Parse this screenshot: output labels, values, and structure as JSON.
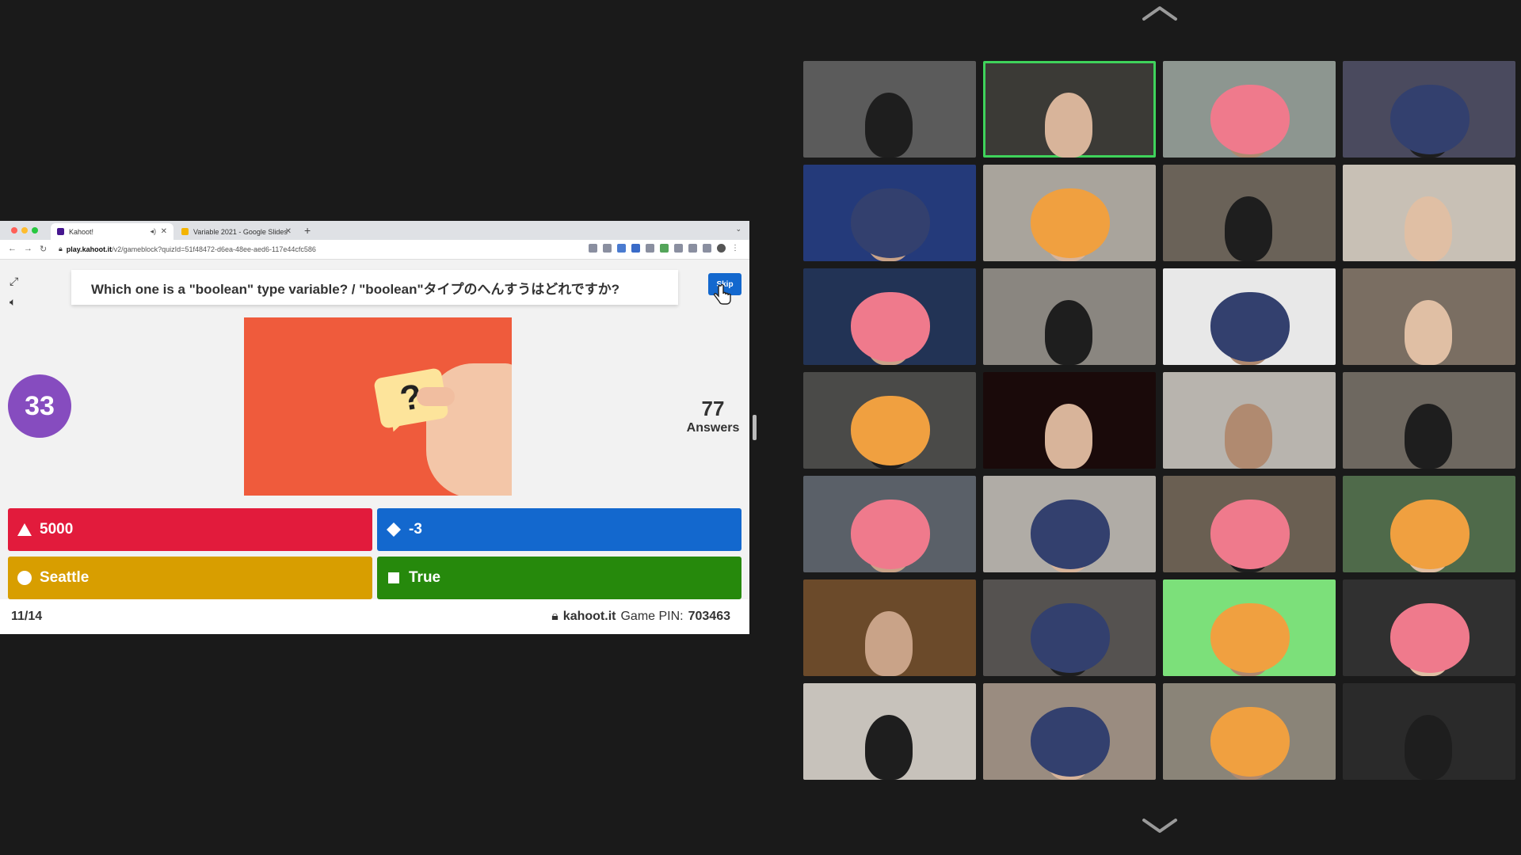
{
  "browser": {
    "tabs": [
      {
        "label": "Kahoot!",
        "active": true
      },
      {
        "label": "Variable 2021 - Google Slides",
        "active": false
      }
    ],
    "url_host": "play.kahoot.it",
    "url_path": "/v2/gameblock?quizId=51f48472-d6ea-48ee-aed6-117e44cfc586"
  },
  "kahoot": {
    "question": "Which one is a \"boolean\" type variable? / \"boolean\"タイプのへんすうはどれですか?",
    "skip_label": "Skip",
    "timer": "33",
    "answers_count": "77",
    "answers_label": "Answers",
    "image_symbol": "?",
    "options": [
      {
        "text": "5000",
        "color": "#e21b3c",
        "shape": "triangle"
      },
      {
        "text": "-3",
        "color": "#1368ce",
        "shape": "diamond"
      },
      {
        "text": "Seattle",
        "color": "#d89e00",
        "shape": "circle"
      },
      {
        "text": "True",
        "color": "#26890c",
        "shape": "square"
      }
    ],
    "progress": "11/14",
    "site": "kahoot.it",
    "pin_label": "Game PIN:",
    "pin": "703463"
  },
  "gallery": {
    "tile_count": 28,
    "active_speaker_tile": 2,
    "accent_active": "#3fd35b"
  }
}
